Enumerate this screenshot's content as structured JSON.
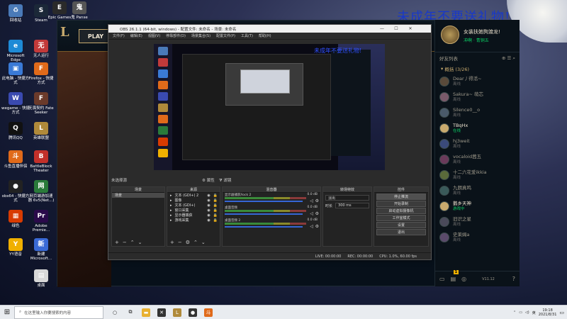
{
  "desktop": {
    "watermark": "未成年不要送礼物!",
    "icons": [
      {
        "label": "回收站",
        "icon": "recycle-bin-icon",
        "color": "#4a7ab8",
        "glyph": "♻"
      },
      {
        "label": "Steam",
        "icon": "steam-icon",
        "color": "#1b2838",
        "glyph": "S"
      },
      {
        "label": "Epic Games",
        "icon": "epic-games-icon",
        "color": "#2a2a2a",
        "glyph": "E"
      },
      {
        "label": "鬼 Panse",
        "icon": "app-icon",
        "color": "#555",
        "glyph": "鬼"
      },
      {
        "label": "Microsoft Edge",
        "icon": "edge-icon",
        "color": "#1e8ad6",
        "glyph": "e"
      },
      {
        "label": "无人运行",
        "icon": "app-icon",
        "color": "#c23a3a",
        "glyph": "无"
      },
      {
        "label": "此电脑 - 快捷方式",
        "icon": "computer-icon",
        "color": "#3a7ad6",
        "glyph": "▣"
      },
      {
        "label": "Firefox - 快捷方式",
        "icon": "firefox-icon",
        "color": "#e06a1a",
        "glyph": "F"
      },
      {
        "label": "wegame - 快捷方式",
        "icon": "wegame-icon",
        "color": "#3a4ab0",
        "glyph": "W"
      },
      {
        "label": "无畏契约 Fate Seeker",
        "icon": "app-icon",
        "color": "#6a3a2a",
        "glyph": "F"
      },
      {
        "label": "腾讯QQ",
        "icon": "qq-icon",
        "color": "#111",
        "glyph": "Q"
      },
      {
        "label": "英雄联盟",
        "icon": "lol-icon",
        "color": "#b08a3a",
        "glyph": "L"
      },
      {
        "label": "斗鱼直播伴侣",
        "icon": "douyu-icon",
        "color": "#e06a1a",
        "glyph": "斗"
      },
      {
        "label": "BattleBlock Theater",
        "icon": "app-icon",
        "color": "#c2302a",
        "glyph": "B"
      },
      {
        "label": "obs64 - 快捷方式",
        "icon": "obs-icon",
        "color": "#222",
        "glyph": "●"
      },
      {
        "label": "网页端游加速 器 6v5(Net...)",
        "icon": "app-icon",
        "color": "#2a7a3a",
        "glyph": "网"
      },
      {
        "label": "绿色",
        "icon": "office-icon",
        "color": "#d83b01",
        "glyph": "▦"
      },
      {
        "label": "Adobe Premie...",
        "icon": "premiere-icon",
        "color": "#2a0a4a",
        "glyph": "Pr"
      },
      {
        "label": "YY语音",
        "icon": "yy-icon",
        "color": "#f0b000",
        "glyph": "Y"
      },
      {
        "label": "新建 Microsoft...",
        "icon": "app-icon",
        "color": "#3a6ad6",
        "glyph": "新"
      },
      {
        "label": "桌面",
        "icon": "folder-icon",
        "color": "#d8d8d8",
        "glyph": "▤"
      }
    ]
  },
  "lol": {
    "play_label": "PLAY",
    "player_name": "女装扶她狗渡龙!",
    "player_status": "冲啊",
    "player_rank": "青铜五",
    "friends_header": "好友列表",
    "group_label": "概括 (3/26)",
    "friends": [
      {
        "name": "Dear丿得活~",
        "status": "离线",
        "online": false,
        "color": "#5a4a3a"
      },
      {
        "name": "Sakura~ 萌芯",
        "status": "离线",
        "online": false,
        "color": "#7a5a6a"
      },
      {
        "name": "Silence0__o",
        "status": "离线",
        "online": false,
        "color": "#4a5a6a"
      },
      {
        "name": "TBqHx",
        "status": "在线",
        "online": true,
        "color": "#c8aa6e"
      },
      {
        "name": "hj3weit",
        "status": "离线",
        "online": false,
        "color": "#3a4a7a"
      },
      {
        "name": "vocaloid茜五",
        "status": "离线",
        "online": false,
        "color": "#6a3a5a"
      },
      {
        "name": "十二六花爱ikkia",
        "status": "离线",
        "online": false,
        "color": "#5a6a3a"
      },
      {
        "name": "九朗真鸣",
        "status": "离线",
        "online": false,
        "color": "#3a5a5a"
      },
      {
        "name": "鹅乡天神",
        "status": "游戏中",
        "online": true,
        "color": "#c8aa6e"
      },
      {
        "name": "旧识之星",
        "status": "离线",
        "online": false,
        "color": "#4a4a5a"
      },
      {
        "name": "史莱姆a",
        "status": "离线",
        "online": false,
        "color": "#5a4a6a"
      }
    ],
    "footer_badge": "1",
    "footer_version": "V11.12"
  },
  "obs": {
    "title": "OBS 26.1.1 (64-bit, windows) - 配置文件: 未命名 - 场景: 未命名",
    "menu": [
      "文件(F)",
      "编辑(E)",
      "视图(V)",
      "停靠部件(D)",
      "场景集合(S)",
      "配置文件(P)",
      "工具(T)",
      "帮助(H)"
    ],
    "scene_label": "未选择源",
    "properties_label": "属性",
    "filters_label": "滤镜",
    "dock_headers": [
      "场景",
      "来源",
      "混音器",
      "转场特效",
      "控件"
    ],
    "scenes": [
      "场景"
    ],
    "sources": [
      "文本 (GDI+) 2",
      "图像",
      "文本 (GDI+)",
      "窗口采集",
      "显示器捕获",
      "游戏采集"
    ],
    "mixer": [
      {
        "name": "显示器捕获/lock 2",
        "db": "0.0 dB"
      },
      {
        "name": "桌面音频",
        "db": "0.0 dB"
      },
      {
        "name": "桌面音频 2",
        "db": "0.0 dB"
      }
    ],
    "transition": {
      "type": "淡出",
      "duration_label": "时长",
      "duration": "300 ms"
    },
    "controls": [
      "停止推流",
      "开始录制",
      "启动虚拟摄像机",
      "工作室模式",
      "设置",
      "退出"
    ],
    "status": {
      "live": "LIVE: 00:00:00",
      "rec": "REC: 00:00:00",
      "cpu": "CPU: 1.0%, 60.00 fps"
    }
  },
  "taskbar": {
    "search_placeholder": "在这里输入你要搜索的内容",
    "time": "19:18",
    "date": "2021/8/31",
    "lang": "英"
  }
}
